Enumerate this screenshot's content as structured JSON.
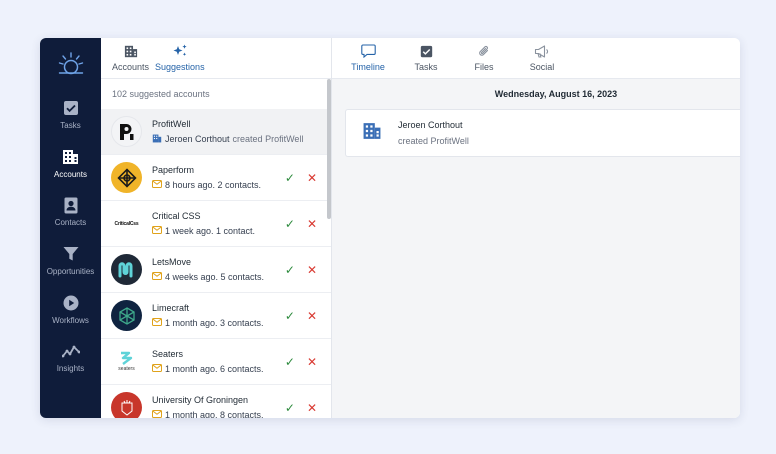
{
  "sidebar": {
    "items": [
      {
        "label": "Tasks",
        "icon": "checkbox-icon",
        "active": false
      },
      {
        "label": "Accounts",
        "icon": "building-icon",
        "active": true
      },
      {
        "label": "Contacts",
        "icon": "contact-card-icon",
        "active": false
      },
      {
        "label": "Opportunities",
        "icon": "funnel-icon",
        "active": false
      },
      {
        "label": "Workflows",
        "icon": "play-circle-icon",
        "active": false
      },
      {
        "label": "Insights",
        "icon": "trend-line-icon",
        "active": false
      }
    ]
  },
  "middle": {
    "tabs": [
      {
        "label": "Accounts",
        "icon": "building-icon"
      },
      {
        "label": "Suggestions",
        "icon": "sparkle-icon"
      }
    ],
    "count_text": "102 suggested accounts",
    "rows": [
      {
        "name": "ProfitWell",
        "sub_strong": "Jeroen Corthout",
        "sub_muted": "created ProfitWell",
        "icon": "building-icon"
      },
      {
        "name": "Paperform",
        "sub_strong": "8 hours ago. 2 contacts.",
        "icon": "envelope-icon"
      },
      {
        "name": "Critical CSS",
        "sub_strong": "1 week ago. 1 contact.",
        "icon": "envelope-icon",
        "logo_text": "CriticalCss"
      },
      {
        "name": "LetsMove",
        "sub_strong": "4 weeks ago. 5 contacts.",
        "icon": "envelope-icon"
      },
      {
        "name": "Limecraft",
        "sub_strong": "1 month ago. 3 contacts.",
        "icon": "envelope-icon"
      },
      {
        "name": "Seaters",
        "sub_strong": "1 month ago. 6 contacts.",
        "icon": "envelope-icon",
        "logo_text": "seaters"
      },
      {
        "name": "University Of Groningen",
        "sub_strong": "1 month ago. 8 contacts.",
        "icon": "envelope-icon"
      }
    ]
  },
  "right": {
    "tabs": [
      {
        "label": "Timeline",
        "icon": "speech-bubble-icon"
      },
      {
        "label": "Tasks",
        "icon": "checkbox-icon"
      },
      {
        "label": "Files",
        "icon": "paperclip-icon"
      },
      {
        "label": "Social",
        "icon": "megaphone-icon"
      }
    ],
    "date": "Wednesday, August 16, 2023",
    "card": {
      "title": "Jeroen Corthout",
      "sub": "created ProfitWell",
      "icon": "building-icon"
    }
  },
  "colors": {
    "sidebar_bg": "#0f1c3a",
    "accent": "#2563a8",
    "accept": "#2e8b3e",
    "reject": "#d93a32"
  }
}
